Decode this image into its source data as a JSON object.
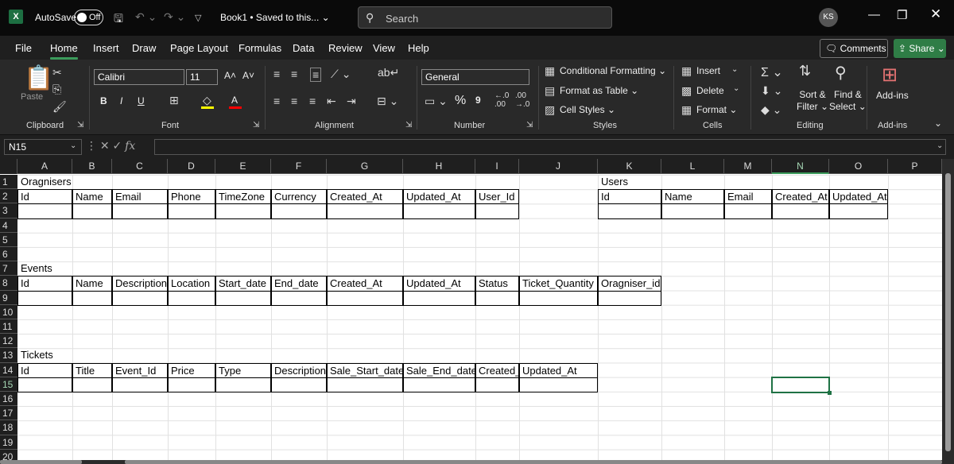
{
  "titlebar": {
    "logo": "X",
    "autosave_label": "AutoSave",
    "toggle_state": "Off",
    "doc_title": "Book1 • Saved to this... ⌄",
    "search_placeholder": "Search",
    "user_initials": "KS"
  },
  "menu": {
    "tabs": [
      "File",
      "Home",
      "Insert",
      "Draw",
      "Page Layout",
      "Formulas",
      "Data",
      "Review",
      "View",
      "Help"
    ],
    "active": "Home",
    "comments": "Comments",
    "share": "Share"
  },
  "ribbon": {
    "clipboard": {
      "label": "Clipboard",
      "paste": "Paste"
    },
    "font": {
      "label": "Font",
      "name": "Calibri",
      "size": "11",
      "bold": "B",
      "italic": "I",
      "underline": "U"
    },
    "alignment": {
      "label": "Alignment"
    },
    "number": {
      "label": "Number",
      "format": "General",
      "percent": "%",
      "comma": "9"
    },
    "styles": {
      "label": "Styles",
      "conditional": "Conditional Formatting",
      "format_table": "Format as Table",
      "cell_styles": "Cell Styles"
    },
    "cells": {
      "label": "Cells",
      "insert": "Insert",
      "delete": "Delete",
      "format": "Format"
    },
    "editing": {
      "label": "Editing",
      "sort_filter_1": "Sort &",
      "sort_filter_2": "Filter",
      "find_select_1": "Find &",
      "find_select_2": "Select"
    },
    "addins": {
      "label": "Add-ins",
      "button": "Add-ins"
    }
  },
  "formula_bar": {
    "name_box": "N15",
    "fx": "fx",
    "value": ""
  },
  "grid": {
    "columns": [
      "A",
      "B",
      "C",
      "D",
      "E",
      "F",
      "G",
      "H",
      "I",
      "J",
      "K",
      "L",
      "M",
      "N",
      "O",
      "P"
    ],
    "rows": [
      "1",
      "2",
      "3",
      "4",
      "5",
      "6",
      "7",
      "8",
      "9",
      "10",
      "11",
      "12",
      "13",
      "14",
      "15",
      "16",
      "17",
      "18",
      "19",
      "20"
    ],
    "selected_col": "N",
    "selected_row": "15",
    "organisers": {
      "title": "Oragnisers",
      "headers": [
        "Id",
        "Name",
        "Email",
        "Phone",
        "TimeZone",
        "Currency",
        "Created_At",
        "Updated_At",
        "User_Id"
      ]
    },
    "users": {
      "title": "Users",
      "headers": [
        "Id",
        "Name",
        "Email",
        "Created_At",
        "Updated_At"
      ]
    },
    "events": {
      "title": "Events",
      "headers": [
        "Id",
        "Name",
        "Description",
        "Location",
        "Start_date",
        "End_date",
        "Created_At",
        "Updated_At",
        "Status",
        "Ticket_Quantity",
        "Oragniser_id"
      ]
    },
    "tickets": {
      "title": "Tickets",
      "headers": [
        "Id",
        "Title",
        "Event_Id",
        "Price",
        "Type",
        "Description",
        "Sale_Start_date",
        "Sale_End_date",
        "Created_",
        "Updated_At"
      ]
    }
  }
}
